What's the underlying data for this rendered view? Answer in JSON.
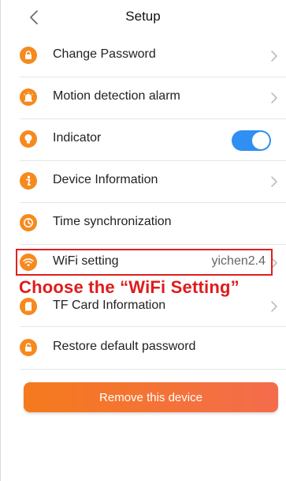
{
  "header": {
    "title": "Setup"
  },
  "settings": {
    "items": [
      {
        "label": "Change Password",
        "icon": "lock-icon",
        "control": "chevron"
      },
      {
        "label": "Motion detection alarm",
        "icon": "alarm-icon",
        "control": "chevron"
      },
      {
        "label": "Indicator",
        "icon": "bulb-icon",
        "control": "toggle",
        "enabled": true
      },
      {
        "label": "Device Information",
        "icon": "info-icon",
        "control": "chevron"
      },
      {
        "label": "Time synchronization",
        "icon": "clock-icon",
        "control": "none"
      },
      {
        "label": "WiFi setting",
        "icon": "wifi-icon",
        "control": "chevron",
        "value": "yichen2.4"
      },
      {
        "label": "TF Card Information",
        "icon": "sd-card-icon",
        "control": "chevron"
      },
      {
        "label": "Restore default password",
        "icon": "unlock-icon",
        "control": "none"
      }
    ]
  },
  "annotation": {
    "text": "Choose the “WiFi Setting”"
  },
  "remove_button": {
    "label": "Remove this device"
  },
  "colors": {
    "icon_orange": "#f68a1e",
    "toggle_blue": "#2f8ff2",
    "annotation_red": "#e01b1b",
    "button_gradient_start": "#f57a1d",
    "button_gradient_end": "#f46c4c"
  }
}
